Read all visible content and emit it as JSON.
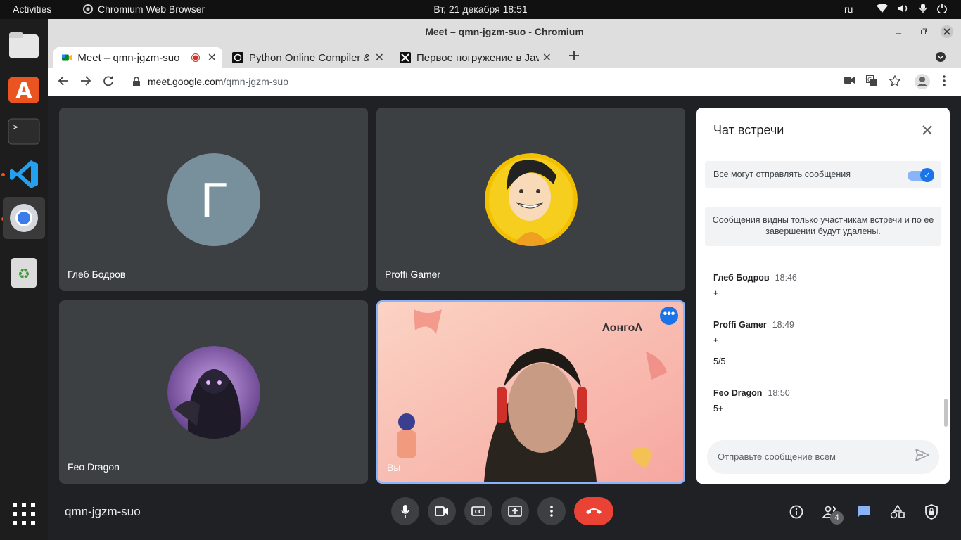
{
  "topbar": {
    "activities": "Activities",
    "app_name": "Chromium Web Browser",
    "clock": "Вт, 21 декабря  18:51",
    "lang": "ru"
  },
  "window": {
    "title": "Meet – qmn-jgzm-suo - Chromium"
  },
  "tabs": [
    {
      "label": "Meet – qmn-jgzm-suo"
    },
    {
      "label": "Python Online Compiler &"
    },
    {
      "label": "Первое погружение в Java"
    }
  ],
  "address": {
    "host": "meet.google.com",
    "path": "/qmn-jgzm-suo"
  },
  "tiles": [
    {
      "name": "Глеб Бодров",
      "initial": "Г"
    },
    {
      "name": "Proffi Gamer"
    },
    {
      "name": "Feo Dragon"
    },
    {
      "name": "Вы"
    }
  ],
  "chat": {
    "title": "Чат встречи",
    "permission_label": "Все могут отправлять сообщения",
    "permission_on": true,
    "notice": "Сообщения видны только участникам встречи и по ее завершении будут удалены.",
    "messages": [
      {
        "author": "Глеб Бодров",
        "time": "18:46",
        "lines": [
          "+"
        ]
      },
      {
        "author": "Proffi Gamer",
        "time": "18:49",
        "lines": [
          "+",
          "5/5"
        ]
      },
      {
        "author": "Feo Dragon",
        "time": "18:50",
        "lines": [
          "5+"
        ]
      }
    ],
    "input_placeholder": "Отправьте сообщение всем"
  },
  "bottom": {
    "meeting_code": "qmn-jgzm-suo",
    "participants_count": "4"
  },
  "colors": {
    "accent": "#1a73e8",
    "end_call": "#ea4335",
    "tile_bg": "#3c4043",
    "page_bg": "#202124"
  }
}
